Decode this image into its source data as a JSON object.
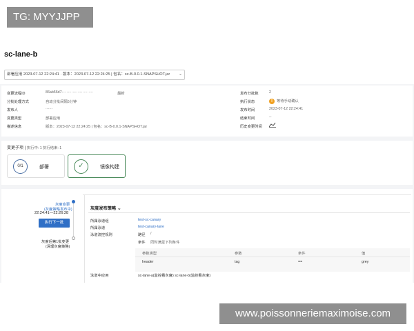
{
  "overlay_tag": "TG: MYYJJPP",
  "watermark": "www.poissonneriemaximoise.com",
  "app_title": "sc-lane-b",
  "deploy_select": "部署应用 2023-07-12 22:24:41 · 版本：2023-07-12 22:24:25 | 包名：sc-B-0.0.1-SNAPSHOT.jar",
  "info": {
    "left": [
      {
        "key": "变更流程ID",
        "value": "86ab56d7-····-····-····-··········",
        "extra": "最新"
      },
      {
        "key": "分批处理方式",
        "value": "自动分批间隔5分钟"
      },
      {
        "key": "发布人",
        "value": "······"
      },
      {
        "key": "变更类型",
        "value": "部署应用"
      },
      {
        "key": "描述信息",
        "value": "版本：2023-07-12 22:24:25 | 包名：sc-B-0.0.1-SNAPSHOT.jar"
      }
    ],
    "right": [
      {
        "key": "发布分批数",
        "value": "2"
      },
      {
        "key": "执行状态",
        "value": "等待手动确认"
      },
      {
        "key": "发布时间",
        "value": "2023-07-12 22:24:41"
      },
      {
        "key": "结束时间",
        "value": "--"
      },
      {
        "key": "历史变更时间",
        "value": ""
      }
    ]
  },
  "subtasks": {
    "heading": "变更子项",
    "summary": "执行中: 1   执行结束: 1",
    "cards": [
      {
        "progress": "0/1",
        "label": "部署"
      },
      {
        "progress": "✓",
        "label": "镜像构建"
      }
    ]
  },
  "timeline": {
    "step1_title": "灰度变更",
    "step1_sub": "(灰度策略发布中)",
    "step1_time": "22:24:41—22:26:28",
    "exec_button": "执行下一批",
    "step2_title": "灰度后第1批变更",
    "step2_sub": "(清理灰度策略)"
  },
  "policy": {
    "header": "灰度发布策略",
    "rows": [
      {
        "key": "所属泳道组",
        "value": "test-sc-canary"
      },
      {
        "key": "所属泳道",
        "value": "test-canary-lane"
      },
      {
        "key": "泳道流控规则",
        "value": ""
      }
    ],
    "route_label": "路径",
    "route_value": "/",
    "cond_label": "条件",
    "cond_value": "同时满足下列条件",
    "table_headers": [
      "参数类型",
      "参数",
      "条件",
      "值"
    ],
    "table_row": [
      "header",
      "tag",
      "==",
      "grey"
    ],
    "lane_apps_label": "泳道中应用",
    "lane_apps_value": "sc-lane-a(监控看灰度)  sc-lane-b(监控看灰度)"
  }
}
